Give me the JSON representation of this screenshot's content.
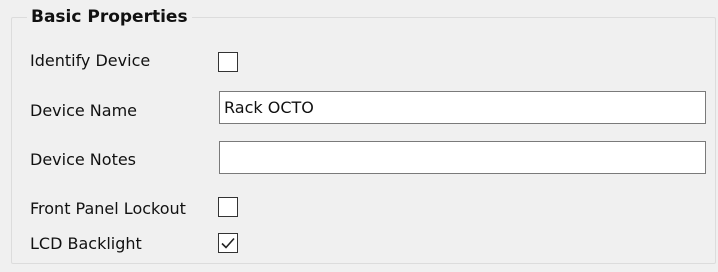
{
  "group": {
    "title": "Basic Properties"
  },
  "fields": {
    "identify_device": {
      "label": "Identify Device",
      "checked": false
    },
    "device_name": {
      "label": "Device Name",
      "value": "Rack OCTO"
    },
    "device_notes": {
      "label": "Device Notes",
      "value": ""
    },
    "front_panel_lockout": {
      "label": "Front Panel Lockout",
      "checked": false
    },
    "lcd_backlight": {
      "label": "LCD Backlight",
      "checked": true
    }
  },
  "icons": {
    "checkmark": "check-icon"
  }
}
